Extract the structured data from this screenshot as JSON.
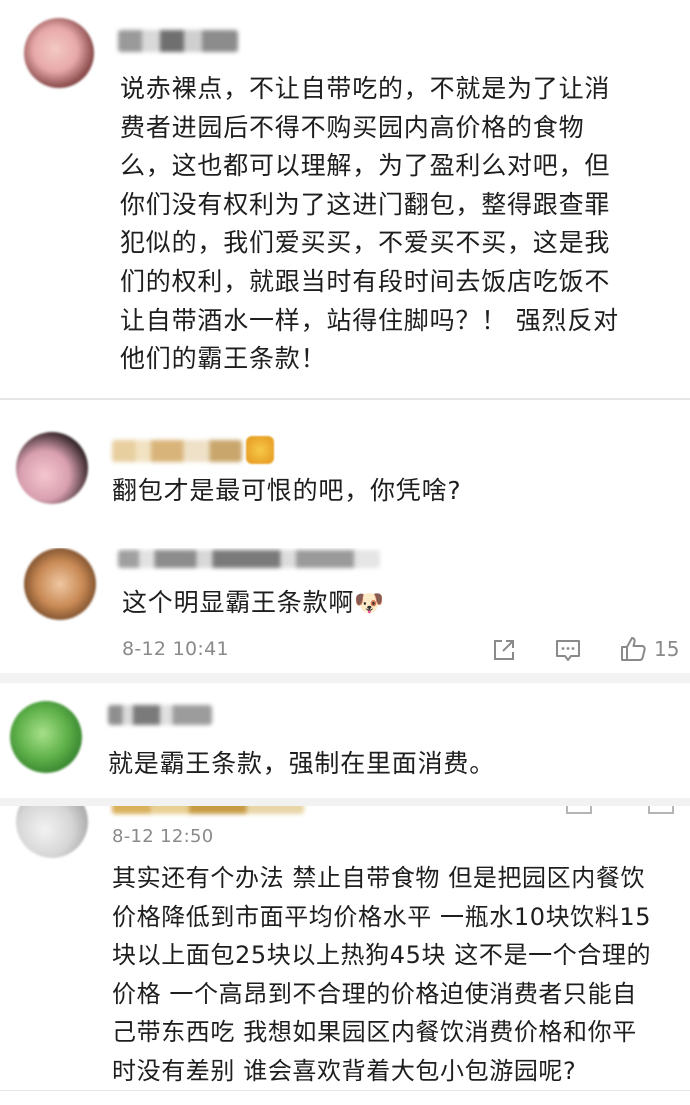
{
  "comments": [
    {
      "text": "说赤裸点，不让自带吃的，不就是为了让消\n费者进园后不得不购买园内高价格的食物\n么，这也都可以理解，为了盈利么对吧，但\n你们没有权利为了这进门翻包，整得跟查罪\n犯似的，我们爱买买，不爱买不买，这是我\n们的权利，就跟当时有段时间去饭店吃饭不\n让自带酒水一样，站得住脚吗？！ 强烈反对\n他们的霸王条款！"
    },
    {
      "text": "翻包才是最可恨的吧，你凭啥?"
    },
    {
      "text": "这个明显霸王条款啊",
      "emoji": "🐶",
      "time": "8-12 10:41",
      "like_count": "15"
    },
    {
      "text": "就是霸王条款，强制在里面消费。"
    },
    {
      "time": "8-12 12:50",
      "text": "其实还有个办法 禁止自带食物 但是把园区内餐饮\n价格降低到市面平均价格水平 一瓶水10块饮料15\n块以上面包25块以上热狗45块 这不是一个合理的\n价格 一个高昂到不合理的价格迫使消费者只能自\n己带东西吃 我想如果园区内餐饮消费价格和你平\n时没有差别 谁会喜欢背着大包小包游园呢?"
    }
  ],
  "icons": {
    "share": "share-icon",
    "comment": "comment-icon",
    "like": "thumbs-up-icon"
  }
}
